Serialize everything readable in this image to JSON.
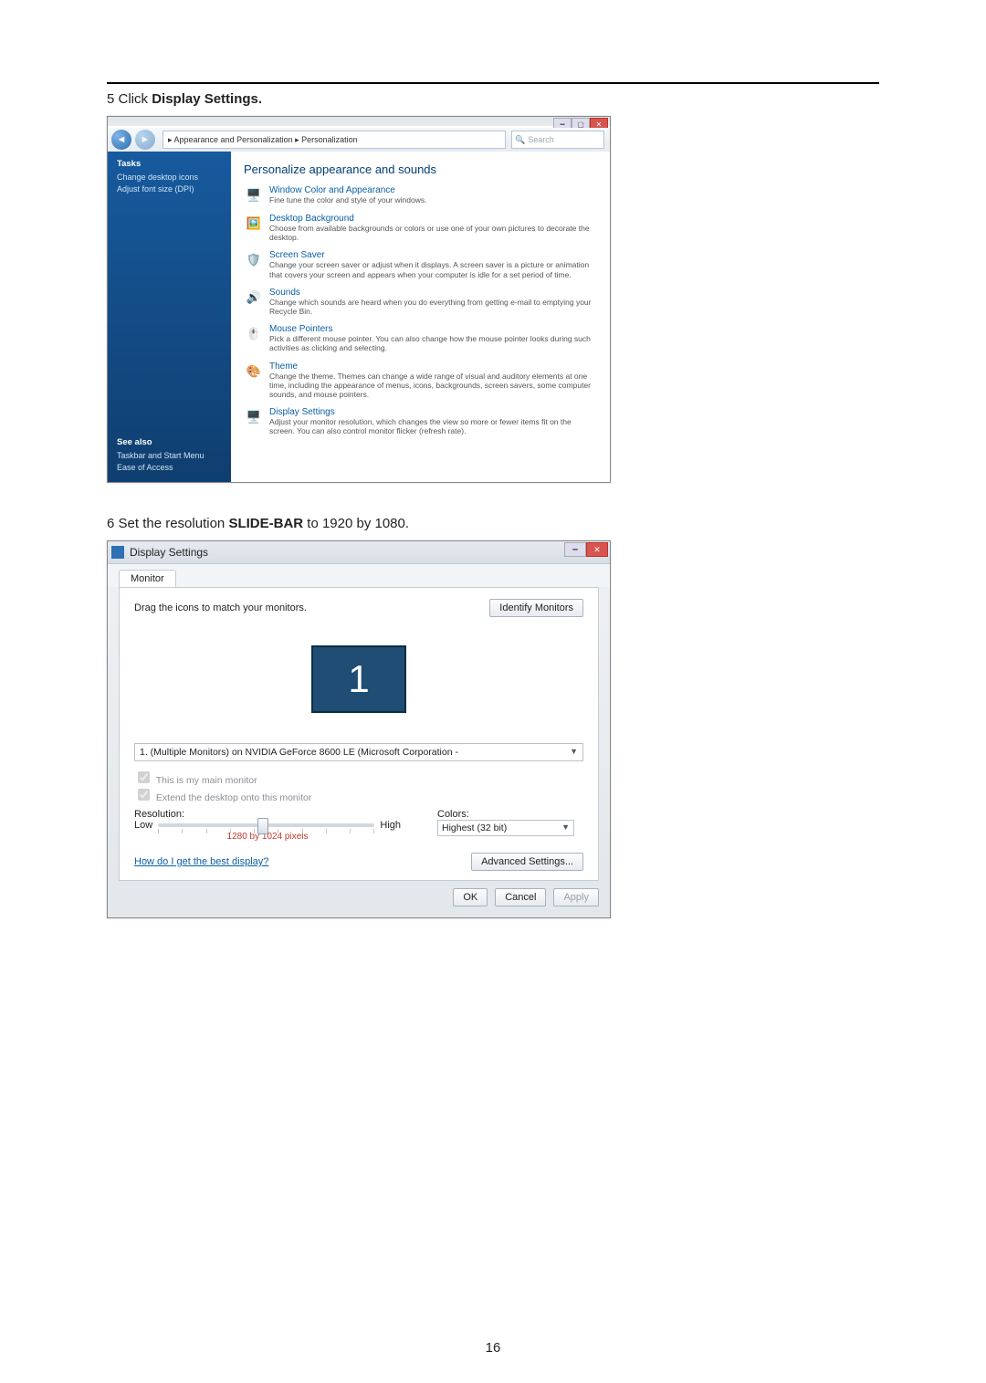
{
  "page_number": "16",
  "step5": {
    "number": "5",
    "prefix": "Click ",
    "bold": "Display Settings."
  },
  "step6": {
    "number": "6",
    "text_before": "Set the resolution ",
    "bold": "SLIDE-BAR",
    "text_after": " to 1920 by 1080."
  },
  "win1": {
    "breadcrumb": "▸ Appearance and Personalization ▸ Personalization",
    "search_placeholder": "Search",
    "sidebar": {
      "tasks_title": "Tasks",
      "tasks": [
        "Change desktop icons",
        "Adjust font size (DPI)"
      ],
      "see_also_title": "See also",
      "see_also": [
        "Taskbar and Start Menu",
        "Ease of Access"
      ]
    },
    "heading": "Personalize appearance and sounds",
    "items": [
      {
        "icon": "🖥️",
        "title": "Window Color and Appearance",
        "desc": "Fine tune the color and style of your windows."
      },
      {
        "icon": "🖼️",
        "title": "Desktop Background",
        "desc": "Choose from available backgrounds or colors or use one of your own pictures to decorate the desktop."
      },
      {
        "icon": "🛡️",
        "title": "Screen Saver",
        "desc": "Change your screen saver or adjust when it displays. A screen saver is a picture or animation that covers your screen and appears when your computer is idle for a set period of time."
      },
      {
        "icon": "🔊",
        "title": "Sounds",
        "desc": "Change which sounds are heard when you do everything from getting e-mail to emptying your Recycle Bin."
      },
      {
        "icon": "🖱️",
        "title": "Mouse Pointers",
        "desc": "Pick a different mouse pointer. You can also change how the mouse pointer looks during such activities as clicking and selecting."
      },
      {
        "icon": "🎨",
        "title": "Theme",
        "desc": "Change the theme. Themes can change a wide range of visual and auditory elements at one time, including the appearance of menus, icons, backgrounds, screen savers, some computer sounds, and mouse pointers."
      },
      {
        "icon": "🖥️",
        "title": "Display Settings",
        "desc": "Adjust your monitor resolution, which changes the view so more or fewer items fit on the screen. You can also control monitor flicker (refresh rate)."
      }
    ]
  },
  "win2": {
    "title": "Display Settings",
    "tab": "Monitor",
    "hint": "Drag the icons to match your monitors.",
    "identify_btn": "Identify Monitors",
    "monitor_number": "1",
    "device": "1. (Multiple Monitors) on NVIDIA GeForce 8600 LE (Microsoft Corporation - ",
    "check_main": "This is my main monitor",
    "check_extend": "Extend the desktop onto this monitor",
    "resolution_label": "Resolution:",
    "low_label": "Low",
    "high_label": "High",
    "resolution_value": "1280 by 1024 pixels",
    "colors_label": "Colors:",
    "colors_value": "Highest (32 bit)",
    "help_link": "How do I get the best display?",
    "advanced_btn": "Advanced Settings...",
    "ok_btn": "OK",
    "cancel_btn": "Cancel",
    "apply_btn": "Apply"
  }
}
